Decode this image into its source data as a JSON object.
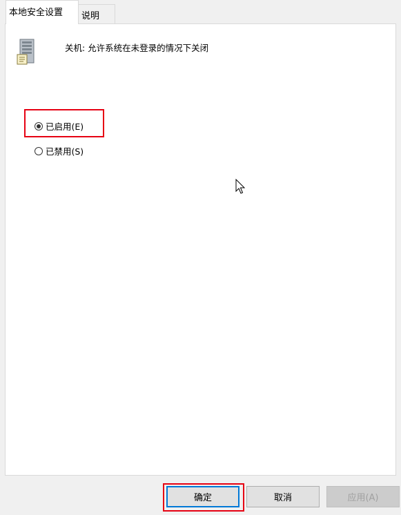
{
  "tabs": [
    {
      "label": "本地安全设置",
      "active": true
    },
    {
      "label": "说明",
      "active": false
    }
  ],
  "policy": {
    "icon": "server-icon",
    "title": "关机: 允许系统在未登录的情况下关闭"
  },
  "options": {
    "enabled_label": "已启用(E)",
    "disabled_label": "已禁用(S)",
    "selected": "enabled"
  },
  "buttons": {
    "ok_label": "确定",
    "cancel_label": "取消",
    "apply_label": "应用(A)"
  },
  "colors": {
    "highlight": "#e60012",
    "focus_border": "#0078d7"
  }
}
